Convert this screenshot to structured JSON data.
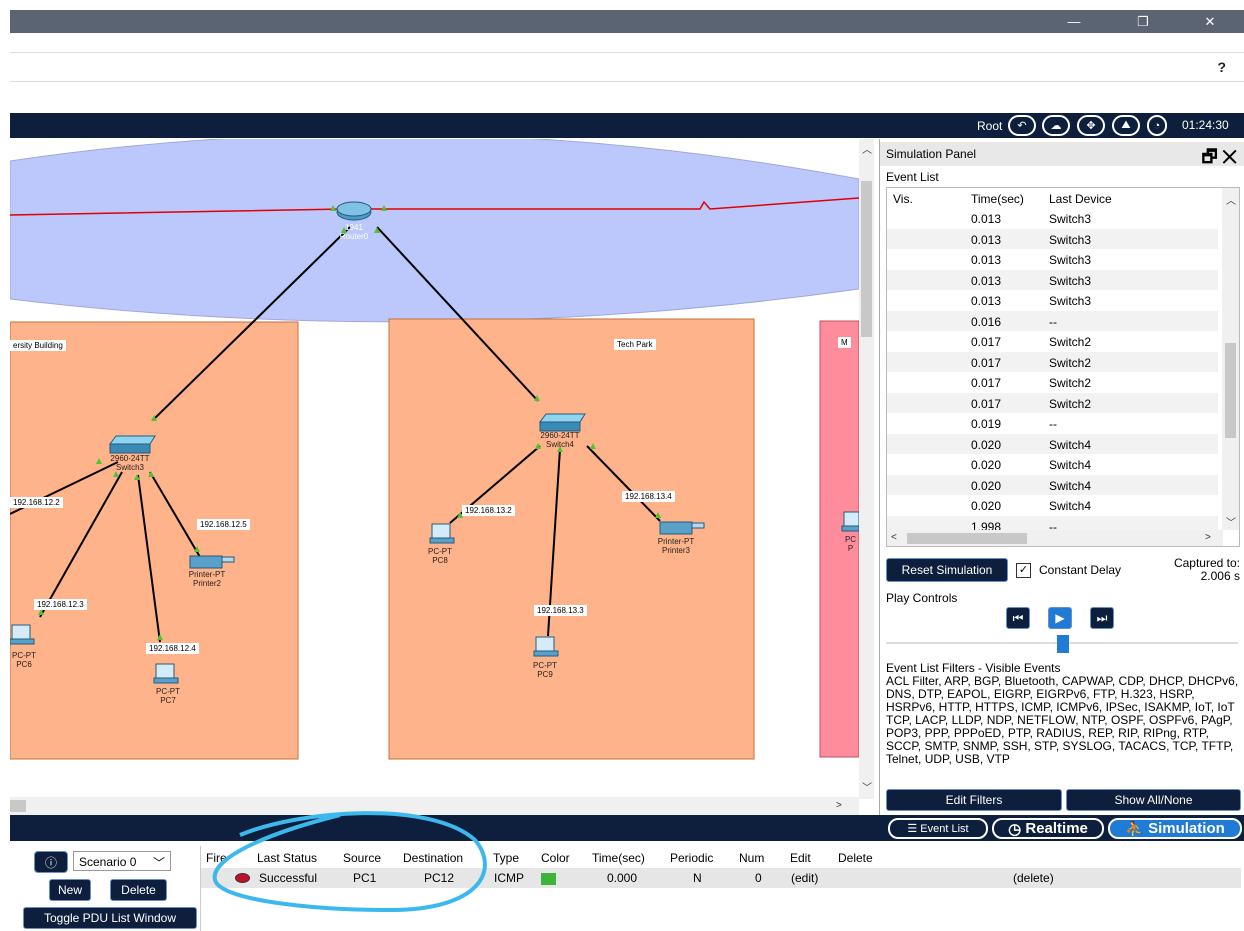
{
  "window": {
    "minimize_icon": "minimize-icon",
    "maximize_icon": "restore-icon",
    "close_icon": "close-icon"
  },
  "menubar": {
    "help": "?"
  },
  "topnav": {
    "root_label": "Root",
    "clock": "01:24:30"
  },
  "topology": {
    "router": {
      "model": "1941",
      "name": "Router0"
    },
    "areas": [
      {
        "label": "ersity Building"
      },
      {
        "label": "Tech Park"
      },
      {
        "label": "M"
      }
    ],
    "switches": [
      {
        "model": "2960-24TT",
        "name": "Switch3"
      },
      {
        "model": "2960-24TT",
        "name": "Switch4"
      }
    ],
    "ip_labels": {
      "left1": "192.168.12.2",
      "left2": "192.168.12.5",
      "left3": "192.168.12.3",
      "left4": "192.168.12.4",
      "mid1": "192.168.13.2",
      "mid2": "192.168.13.4",
      "mid3": "192.168.13.3"
    },
    "devices": {
      "printer2": {
        "type": "Printer-PT",
        "name": "Printer2"
      },
      "pc6": {
        "type": "PC-PT",
        "name": "PC6"
      },
      "pc7": {
        "type": "PC-PT",
        "name": "PC7"
      },
      "pc8": {
        "type": "PC-PT",
        "name": "PC8"
      },
      "pc9": {
        "type": "PC-PT",
        "name": "PC9"
      },
      "printer3": {
        "type": "Printer-PT",
        "name": "Printer3"
      },
      "edge_pc": {
        "type": "PC",
        "name": "P"
      }
    }
  },
  "sim_panel": {
    "title": "Simulation Panel",
    "event_list_label": "Event List",
    "columns": {
      "vis": "Vis.",
      "time": "Time(sec)",
      "device": "Last Device"
    },
    "events": [
      {
        "time": "0.013",
        "device": "Switch3"
      },
      {
        "time": "0.013",
        "device": "Switch3"
      },
      {
        "time": "0.013",
        "device": "Switch3"
      },
      {
        "time": "0.013",
        "device": "Switch3"
      },
      {
        "time": "0.013",
        "device": "Switch3"
      },
      {
        "time": "0.016",
        "device": "--"
      },
      {
        "time": "0.017",
        "device": "Switch2"
      },
      {
        "time": "0.017",
        "device": "Switch2"
      },
      {
        "time": "0.017",
        "device": "Switch2"
      },
      {
        "time": "0.017",
        "device": "Switch2"
      },
      {
        "time": "0.019",
        "device": "--"
      },
      {
        "time": "0.020",
        "device": "Switch4"
      },
      {
        "time": "0.020",
        "device": "Switch4"
      },
      {
        "time": "0.020",
        "device": "Switch4"
      },
      {
        "time": "0.020",
        "device": "Switch4"
      },
      {
        "time": "1.998",
        "device": "--"
      }
    ],
    "reset_button": "Reset Simulation",
    "constant_delay": "Constant Delay",
    "captured_label": "Captured to:",
    "captured_value": "2.006 s",
    "play_controls_label": "Play Controls",
    "filters_title": "Event List Filters - Visible Events",
    "filters_text": "ACL Filter, ARP, BGP, Bluetooth, CAPWAP, CDP, DHCP, DHCPv6, DNS, DTP, EAPOL, EIGRP, EIGRPv6, FTP, H.323, HSRP, HSRPv6, HTTP, HTTPS, ICMP, ICMPv6, IPSec, ISAKMP, IoT, IoT TCP, LACP, LLDP, NDP, NETFLOW, NTP, OSPF, OSPFv6, PAgP, POP3, PPP, PPPoED, PTP, RADIUS, REP, RIP, RIPng, RTP, SCCP, SMTP, SNMP, SSH, STP, SYSLOG, TACACS, TCP, TFTP, Telnet, UDP, USB, VTP",
    "edit_filters": "Edit Filters",
    "show_all": "Show All/None"
  },
  "modes": {
    "event_list": "Event List",
    "realtime": "Realtime",
    "simulation": "Simulation"
  },
  "pdu": {
    "scenario": "Scenario 0",
    "new_button": "New",
    "delete_button": "Delete",
    "toggle_button": "Toggle PDU List Window",
    "columns": [
      "Fire",
      "Last Status",
      "Source",
      "Destination",
      "Type",
      "Color",
      "Time(sec)",
      "Periodic",
      "Num",
      "Edit",
      "Delete"
    ],
    "row": {
      "status": "Successful",
      "source": "PC1",
      "destination": "PC12",
      "type": "ICMP",
      "color": "#3cb43c",
      "time": "0.000",
      "periodic": "N",
      "num": "0",
      "edit": "(edit)",
      "delete": "(delete)"
    }
  }
}
